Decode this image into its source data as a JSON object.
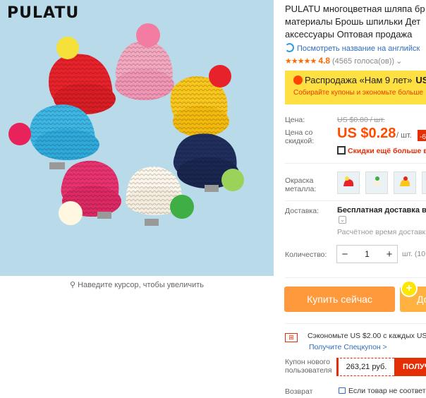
{
  "gallery": {
    "brand_logo": "PULATU",
    "zoom_hint": "Наведите курсор, чтобы увеличить"
  },
  "product": {
    "title_line1": "PULATU многоцветная шляпа бр",
    "title_line2": "материалы Брошь шпильки Дет",
    "title_line3": "аксессуары Оптовая продажа",
    "translate_link": "Посмотреть название на английск",
    "rating_stars": "★★★★★",
    "rating_score": "4.8",
    "rating_votes": "(4565 голоса(ов))",
    "rating_chevron": "⌄"
  },
  "sale_banner": {
    "title": "Распродажа «Нам 9 лет»",
    "title_suffix": "US",
    "subtitle": "Собирайте купоны и экономьте больше"
  },
  "pricing": {
    "price_label": "Цена:",
    "old_price": "US $0.80 / шт.",
    "discount_label_line1": "Цена со",
    "discount_label_line2": "скидкой:",
    "price": "US $0.28",
    "per_unit": "/ шт.",
    "discount_badge": "-6",
    "coupon_more": "Скидки ещё больше в"
  },
  "options": {
    "color_label_line1": "Окраска",
    "color_label_line2": "металла:",
    "thumbs": [
      "red-hat",
      "white-hat",
      "yellow-hat",
      "blue-hat"
    ]
  },
  "shipping": {
    "label": "Доставка:",
    "value": "Бесплатная доставка в",
    "dropdown": "⌄",
    "estimate": "Расчётное время доставк"
  },
  "quantity": {
    "label": "Количество:",
    "minus": "−",
    "value": "1",
    "plus": "+",
    "unit": "шт. (10"
  },
  "actions": {
    "buy_now": "Купить сейчас",
    "add_to_cart": "До",
    "plus_badge": "+"
  },
  "promo": {
    "gift_icon": "⊞",
    "save_text": "Сэкономьте US $2.00 с каждых US",
    "special_link": "Получите Спецкупон >",
    "new_user_label_line1": "Купон нового",
    "new_user_label_line2": "пользователя",
    "coupon_value": "263,21 руб.",
    "coupon_button": "ПОЛУЧ",
    "return_label": "Возврат",
    "return_text": "Если товар не соответ"
  },
  "colors": {
    "accent": "#ff4c00",
    "sale_yellow": "#ffe042",
    "buy_orange": "#ff9a3c",
    "cart_orange": "#ffb23f",
    "link_blue": "#2e6dbf",
    "image_bg": "#b9dae9"
  }
}
